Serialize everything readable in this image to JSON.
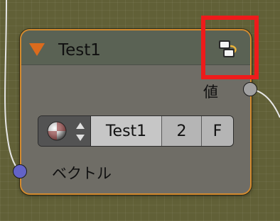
{
  "colors": {
    "canvas_background": "#616037",
    "node_border_selected": "#d38b2f",
    "node_body": "#6f6d66",
    "node_header": "#5a6254",
    "collapse_arrow": "#db6b1d",
    "output_socket": "#a1a1a1",
    "input_socket": "#6363c7",
    "annotation_box": "#ee1b1b",
    "icon_accent": "#e8b23a"
  },
  "node": {
    "title": "Test1",
    "collapse_icon": "triangle-down-icon",
    "header_icon": "node-tree-icon",
    "outputs": [
      {
        "label": "値",
        "socket_icon": "socket-circle-icon"
      }
    ],
    "inputs": [
      {
        "label": "ベクトル",
        "socket_icon": "socket-circle-icon"
      }
    ],
    "datablock": {
      "browse_icon": "material-sphere-icon",
      "arrows_icon": "up-down-arrows-icon",
      "name": "Test1",
      "users": "2",
      "fake_user": "F"
    }
  }
}
